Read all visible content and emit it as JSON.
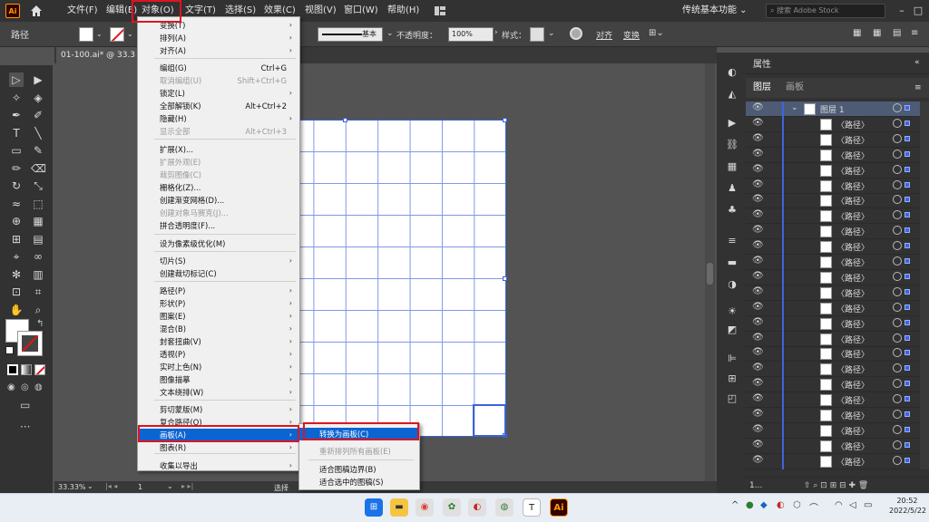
{
  "app": {
    "logo": "Ai"
  },
  "menubar": {
    "items": [
      "文件(F)",
      "编辑(E)",
      "对象(O)",
      "文字(T)",
      "选择(S)",
      "效果(C)",
      "视图(V)",
      "窗口(W)",
      "帮助(H)"
    ],
    "workspace": "传统基本功能",
    "search_placeholder": "搜索 Adobe Stock"
  },
  "options": {
    "path_label": "路径",
    "stroke_style": "基本",
    "opacity_label": "不透明度：",
    "opacity_value": "100%",
    "style_label": "样式：",
    "align_label": "对齐",
    "transform_label": "变换"
  },
  "document": {
    "tab": "01-100.ai* @ 33.3",
    "zoom": "33.33%",
    "page": "1",
    "status": "选择"
  },
  "object_menu": {
    "items": [
      {
        "label": "变换(T)",
        "arrow": true
      },
      {
        "label": "排列(A)",
        "arrow": true
      },
      {
        "label": "对齐(A)",
        "arrow": true
      },
      {
        "label": "编组(G)",
        "shortcut": "Ctrl+G"
      },
      {
        "label": "取消编组(U)",
        "shortcut": "Shift+Ctrl+G",
        "disabled": true
      },
      {
        "label": "锁定(L)",
        "arrow": true
      },
      {
        "label": "全部解锁(K)",
        "shortcut": "Alt+Ctrl+2"
      },
      {
        "label": "隐藏(H)",
        "arrow": true
      },
      {
        "label": "显示全部",
        "shortcut": "Alt+Ctrl+3",
        "disabled": true
      },
      {
        "label": "扩展(X)..."
      },
      {
        "label": "扩展外观(E)",
        "disabled": true
      },
      {
        "label": "裁剪图像(C)",
        "disabled": true
      },
      {
        "label": "栅格化(Z)..."
      },
      {
        "label": "创建渐变网格(D)..."
      },
      {
        "label": "创建对象马赛克(J)...",
        "disabled": true
      },
      {
        "label": "拼合透明度(F)..."
      },
      {
        "label": "设为像素级优化(M)"
      },
      {
        "label": "切片(S)",
        "arrow": true
      },
      {
        "label": "创建裁切标记(C)"
      },
      {
        "label": "路径(P)",
        "arrow": true
      },
      {
        "label": "形状(P)",
        "arrow": true
      },
      {
        "label": "图案(E)",
        "arrow": true
      },
      {
        "label": "混合(B)",
        "arrow": true
      },
      {
        "label": "封套扭曲(V)",
        "arrow": true
      },
      {
        "label": "透视(P)",
        "arrow": true
      },
      {
        "label": "实时上色(N)",
        "arrow": true
      },
      {
        "label": "图像描摹",
        "arrow": true
      },
      {
        "label": "文本绕排(W)",
        "arrow": true
      },
      {
        "label": "剪切蒙版(M)",
        "arrow": true
      },
      {
        "label": "复合路径(O)",
        "arrow": true
      },
      {
        "label": "画板(A)",
        "arrow": true,
        "highlighted": true
      },
      {
        "label": "图表(R)",
        "arrow": true
      },
      {
        "label": "收集以导出",
        "arrow": true
      }
    ]
  },
  "artboard_submenu": {
    "items": [
      {
        "label": "转换为画板(C)",
        "highlighted": true
      },
      {
        "label": "重新排列所有画板(E)",
        "disabled": true
      },
      {
        "label": "适合图稿边界(B)"
      },
      {
        "label": "适合选中的图稿(S)"
      }
    ]
  },
  "panels": {
    "properties_title": "属性",
    "tab_layers": "图层",
    "tab_artboards": "画板",
    "layer_name": "图层 1",
    "sublayer_name": "〈路径〉",
    "footer_count": "1..."
  },
  "taskbar": {
    "time": "20:52",
    "date": "2022/5/22"
  },
  "colors": {
    "accent": "#0a64d1",
    "highlight_box": "#e0141e",
    "guide": "#3f65d9"
  }
}
